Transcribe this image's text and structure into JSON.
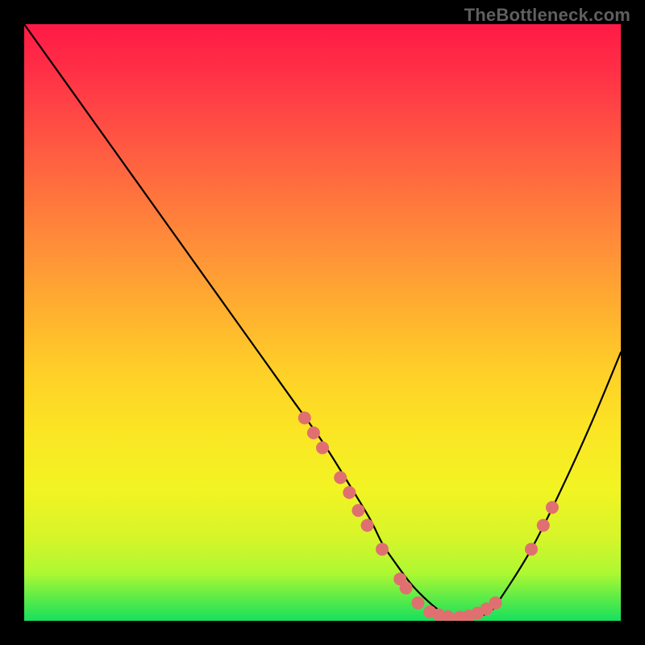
{
  "watermark": "TheBottleneck.com",
  "colors": {
    "background": "#000000",
    "curve_stroke": "#000000",
    "marker_fill": "#e07070",
    "watermark_text": "#5f5f5f"
  },
  "chart_data": {
    "type": "line",
    "title": "",
    "xlabel": "",
    "ylabel": "",
    "xlim": [
      0,
      100
    ],
    "ylim": [
      0,
      100
    ],
    "x": [
      0,
      5,
      10,
      15,
      20,
      25,
      30,
      35,
      40,
      45,
      50,
      55,
      58,
      60,
      62,
      65,
      68,
      70,
      72,
      75,
      78,
      80,
      85,
      90,
      95,
      100
    ],
    "y": [
      100,
      93,
      86,
      79,
      72,
      65,
      58,
      51,
      44,
      37,
      30,
      22,
      17,
      13,
      10,
      6,
      3,
      1.5,
      0.8,
      0.5,
      1.5,
      4,
      12,
      22,
      33,
      45
    ],
    "series": [
      {
        "name": "bottleneck-curve",
        "style": "line"
      },
      {
        "name": "highlight-markers",
        "style": "points",
        "points": [
          {
            "x": 47,
            "y": 34
          },
          {
            "x": 48.5,
            "y": 31.5
          },
          {
            "x": 50,
            "y": 29
          },
          {
            "x": 53,
            "y": 24
          },
          {
            "x": 54.5,
            "y": 21.5
          },
          {
            "x": 56,
            "y": 18.5
          },
          {
            "x": 57.5,
            "y": 16
          },
          {
            "x": 60,
            "y": 12
          },
          {
            "x": 63,
            "y": 7
          },
          {
            "x": 64,
            "y": 5.5
          },
          {
            "x": 66,
            "y": 3
          },
          {
            "x": 68,
            "y": 1.5
          },
          {
            "x": 69.5,
            "y": 1
          },
          {
            "x": 71,
            "y": 0.7
          },
          {
            "x": 73,
            "y": 0.6
          },
          {
            "x": 74.5,
            "y": 0.8
          },
          {
            "x": 76,
            "y": 1.3
          },
          {
            "x": 77.5,
            "y": 2
          },
          {
            "x": 79,
            "y": 3
          },
          {
            "x": 85,
            "y": 12
          },
          {
            "x": 87,
            "y": 16
          },
          {
            "x": 88.5,
            "y": 19
          }
        ]
      }
    ]
  }
}
